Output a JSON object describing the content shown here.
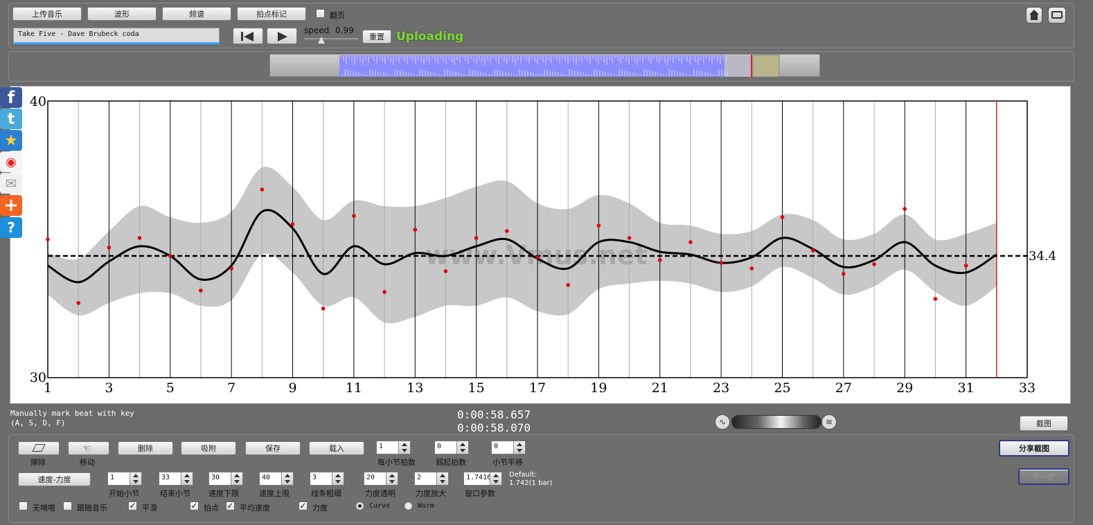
{
  "toolbar": {
    "upload_music": "上传音乐",
    "waveform": "波形",
    "spectrum": "频谱",
    "beat_mark": "拍点标记",
    "page_turn": "翻页",
    "song_title": "Take Five - Dave Brubeck coda",
    "speed_label": "speed",
    "speed_value": "0.99",
    "reset": "重置",
    "status": "Uploading"
  },
  "chart_data": {
    "type": "line",
    "xlim": [
      1,
      33
    ],
    "ylim": [
      30,
      40
    ],
    "x_ticks": [
      "1",
      "3",
      "5",
      "7",
      "9",
      "11",
      "13",
      "15",
      "17",
      "19",
      "21",
      "23",
      "25",
      "27",
      "29",
      "31",
      "33"
    ],
    "y_ticks": [
      "30",
      "40"
    ],
    "average_label": "34.4",
    "average": 34.4,
    "watermark": "www.Vmus.net",
    "cursor_x": 32,
    "points": [
      {
        "x": 1,
        "y": 35.0
      },
      {
        "x": 2,
        "y": 32.7
      },
      {
        "x": 3,
        "y": 34.7
      },
      {
        "x": 4,
        "y": 35.05
      },
      {
        "x": 5,
        "y": 34.4
      },
      {
        "x": 6,
        "y": 33.15
      },
      {
        "x": 7,
        "y": 33.95
      },
      {
        "x": 8,
        "y": 36.8
      },
      {
        "x": 9,
        "y": 35.55
      },
      {
        "x": 10,
        "y": 32.5
      },
      {
        "x": 11,
        "y": 35.85
      },
      {
        "x": 12,
        "y": 33.1
      },
      {
        "x": 13,
        "y": 35.35
      },
      {
        "x": 14,
        "y": 33.85
      },
      {
        "x": 15,
        "y": 35.05
      },
      {
        "x": 16,
        "y": 35.3
      },
      {
        "x": 17,
        "y": 34.35
      },
      {
        "x": 18,
        "y": 33.35
      },
      {
        "x": 19,
        "y": 35.5
      },
      {
        "x": 20,
        "y": 35.05
      },
      {
        "x": 21,
        "y": 34.25
      },
      {
        "x": 22,
        "y": 34.9
      },
      {
        "x": 23,
        "y": 34.15
      },
      {
        "x": 24,
        "y": 33.95
      },
      {
        "x": 25,
        "y": 35.8
      },
      {
        "x": 26,
        "y": 34.6
      },
      {
        "x": 27,
        "y": 33.75
      },
      {
        "x": 28,
        "y": 34.1
      },
      {
        "x": 29,
        "y": 36.1
      },
      {
        "x": 30,
        "y": 32.85
      },
      {
        "x": 31,
        "y": 34.05
      }
    ],
    "curve": [
      {
        "x": 1,
        "y": 34.05
      },
      {
        "x": 2,
        "y": 33.45
      },
      {
        "x": 3,
        "y": 34.2
      },
      {
        "x": 4,
        "y": 34.75
      },
      {
        "x": 5,
        "y": 34.4
      },
      {
        "x": 6,
        "y": 33.55
      },
      {
        "x": 7,
        "y": 34.05
      },
      {
        "x": 8,
        "y": 36.0
      },
      {
        "x": 9,
        "y": 35.4
      },
      {
        "x": 10,
        "y": 33.75
      },
      {
        "x": 11,
        "y": 34.75
      },
      {
        "x": 12,
        "y": 34.1
      },
      {
        "x": 13,
        "y": 34.5
      },
      {
        "x": 14,
        "y": 34.4
      },
      {
        "x": 15,
        "y": 34.75
      },
      {
        "x": 16,
        "y": 35.0
      },
      {
        "x": 17,
        "y": 34.3
      },
      {
        "x": 18,
        "y": 33.95
      },
      {
        "x": 19,
        "y": 34.9
      },
      {
        "x": 20,
        "y": 34.9
      },
      {
        "x": 21,
        "y": 34.55
      },
      {
        "x": 22,
        "y": 34.45
      },
      {
        "x": 23,
        "y": 34.15
      },
      {
        "x": 24,
        "y": 34.35
      },
      {
        "x": 25,
        "y": 35.05
      },
      {
        "x": 26,
        "y": 34.65
      },
      {
        "x": 27,
        "y": 34.0
      },
      {
        "x": 28,
        "y": 34.25
      },
      {
        "x": 29,
        "y": 34.9
      },
      {
        "x": 30,
        "y": 34.05
      },
      {
        "x": 31,
        "y": 33.8
      },
      {
        "x": 32,
        "y": 34.45
      }
    ],
    "band_upper": [
      {
        "x": 1,
        "y": 34.5
      },
      {
        "x": 2,
        "y": 34.3
      },
      {
        "x": 3,
        "y": 35.3
      },
      {
        "x": 4,
        "y": 36.2
      },
      {
        "x": 5,
        "y": 35.8
      },
      {
        "x": 6,
        "y": 35.6
      },
      {
        "x": 7,
        "y": 36.0
      },
      {
        "x": 8,
        "y": 37.6
      },
      {
        "x": 9,
        "y": 36.9
      },
      {
        "x": 10,
        "y": 35.7
      },
      {
        "x": 11,
        "y": 36.4
      },
      {
        "x": 12,
        "y": 36.2
      },
      {
        "x": 13,
        "y": 36.2
      },
      {
        "x": 14,
        "y": 36.5
      },
      {
        "x": 15,
        "y": 36.9
      },
      {
        "x": 16,
        "y": 37.1
      },
      {
        "x": 17,
        "y": 36.3
      },
      {
        "x": 18,
        "y": 36.1
      },
      {
        "x": 19,
        "y": 36.6
      },
      {
        "x": 20,
        "y": 36.3
      },
      {
        "x": 21,
        "y": 35.6
      },
      {
        "x": 22,
        "y": 35.5
      },
      {
        "x": 23,
        "y": 35.2
      },
      {
        "x": 24,
        "y": 35.3
      },
      {
        "x": 25,
        "y": 35.9
      },
      {
        "x": 26,
        "y": 35.7
      },
      {
        "x": 27,
        "y": 35.0
      },
      {
        "x": 28,
        "y": 35.2
      },
      {
        "x": 29,
        "y": 35.9
      },
      {
        "x": 30,
        "y": 35.0
      },
      {
        "x": 31,
        "y": 35.2
      },
      {
        "x": 32,
        "y": 35.6
      }
    ],
    "band_lower": [
      {
        "x": 1,
        "y": 33.0
      },
      {
        "x": 2,
        "y": 32.25
      },
      {
        "x": 3,
        "y": 32.7
      },
      {
        "x": 4,
        "y": 33.05
      },
      {
        "x": 5,
        "y": 33.05
      },
      {
        "x": 6,
        "y": 32.6
      },
      {
        "x": 7,
        "y": 32.8
      },
      {
        "x": 8,
        "y": 34.45
      },
      {
        "x": 9,
        "y": 33.8
      },
      {
        "x": 10,
        "y": 32.6
      },
      {
        "x": 11,
        "y": 32.9
      },
      {
        "x": 12,
        "y": 32.0
      },
      {
        "x": 13,
        "y": 32.2
      },
      {
        "x": 14,
        "y": 32.6
      },
      {
        "x": 15,
        "y": 32.6
      },
      {
        "x": 16,
        "y": 32.9
      },
      {
        "x": 17,
        "y": 32.4
      },
      {
        "x": 18,
        "y": 32.3
      },
      {
        "x": 19,
        "y": 33.2
      },
      {
        "x": 20,
        "y": 33.4
      },
      {
        "x": 21,
        "y": 33.5
      },
      {
        "x": 22,
        "y": 33.4
      },
      {
        "x": 23,
        "y": 33.1
      },
      {
        "x": 24,
        "y": 33.3
      },
      {
        "x": 25,
        "y": 34.0
      },
      {
        "x": 26,
        "y": 33.6
      },
      {
        "x": 27,
        "y": 33.0
      },
      {
        "x": 28,
        "y": 33.3
      },
      {
        "x": 29,
        "y": 33.9
      },
      {
        "x": 30,
        "y": 33.1
      },
      {
        "x": 31,
        "y": 32.6
      },
      {
        "x": 32,
        "y": 33.3
      }
    ],
    "grid": true
  },
  "status_bar": {
    "hint_line1": "Manually mark beat with key",
    "hint_line2": "(A, S, D, F)",
    "time1": "0:00:58.657",
    "time2": "0:00:58.070",
    "screenshot": "截图"
  },
  "controls": {
    "erase": "擦除",
    "move": "移动",
    "delete": "删除",
    "snap": "吸附",
    "save": "保存",
    "load": "载入",
    "beats_per_bar_value": "1",
    "beats_per_bar": "每小节拍数",
    "weak_beat_value": "0",
    "weak_beat": "弱起拍数",
    "bar_shift_value": "0",
    "bar_shift": "小节平移",
    "share_screenshot": "分享截图",
    "next_button": "下一步",
    "mode_button": "速度-力度",
    "start_bar_value": "1",
    "start_bar": "开始小节",
    "end_bar_value": "33",
    "end_bar": "结束小节",
    "speed_min_value": "30",
    "speed_min": "速度下限",
    "speed_max_value": "40",
    "speed_max": "速度上限",
    "line_width_value": "3",
    "line_width": "线条粗细",
    "dyn_opacity_value": "20",
    "dyn_opacity": "力度透明",
    "dyn_scale_value": "2",
    "dyn_scale": "力度放大",
    "window_value": "1.7416",
    "window": "窗口参数",
    "default_line1": "Default:",
    "default_line2": "1.742(1 bar)",
    "no_stutter": "无嘀嗒",
    "follow_music": "跟随音乐",
    "smooth": "平滑",
    "beat_points": "拍点",
    "avg_speed": "平均速度",
    "dynamics": "力度",
    "curve": "Curve",
    "worm": "Worm"
  },
  "colors": {
    "accent_green": "#7cd63a",
    "waveform": "#8a8cff",
    "cursor": "#e02020",
    "points": "#dd0000"
  },
  "icons": [
    "home-icon",
    "fullscreen-icon",
    "facebook-icon",
    "twitter-icon",
    "favorite-icon",
    "weibo-icon",
    "mail-icon",
    "add-icon",
    "help-icon"
  ]
}
